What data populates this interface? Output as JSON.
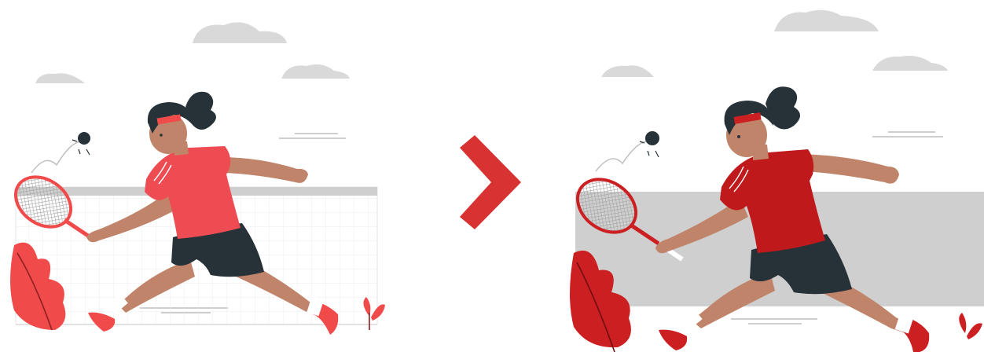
{
  "colors": {
    "background": "#ffffff",
    "cloud": "#d9d9d9",
    "net": "#cfcfcf",
    "net_grid": "#eeeeee",
    "before_shirt": "#ef4b52",
    "before_accent": "#f04a4a",
    "after_shirt": "#c0191c",
    "after_accent": "#cc1f22",
    "arrow": "#d93232",
    "skin": "#c0846a",
    "hair": "#263238",
    "shorts": "#263238",
    "sock": "#ffffff",
    "grass_line": "#bdbdbd"
  },
  "panels": [
    {
      "name": "before-illustration",
      "style": "original"
    },
    {
      "name": "after-illustration",
      "style": "edited"
    }
  ],
  "icons": [
    "chevron-right-arrow-icon"
  ]
}
